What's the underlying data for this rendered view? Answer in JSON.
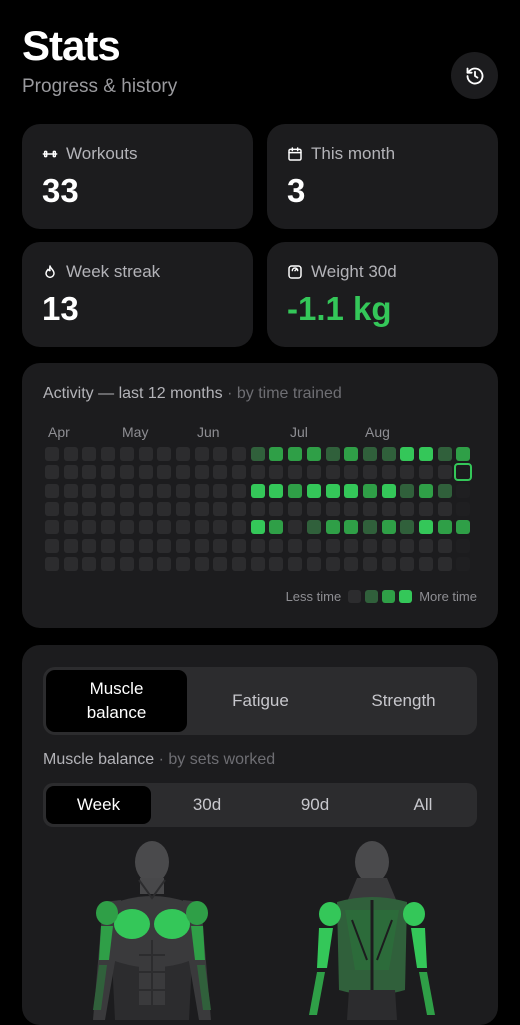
{
  "header": {
    "title": "Stats",
    "subtitle": "Progress & history"
  },
  "stats": [
    {
      "label": "Workouts",
      "value": "33",
      "icon": "dumbbell-icon"
    },
    {
      "label": "This month",
      "value": "3",
      "icon": "calendar-icon"
    },
    {
      "label": "Week streak",
      "value": "13",
      "icon": "flame-icon"
    },
    {
      "label": "Weight 30d",
      "value": "-1.1 kg",
      "icon": "scale-icon",
      "accent": "#34c759"
    }
  ],
  "activity": {
    "title": "Activity — last 12 months",
    "subtitle": "· by time trained",
    "months": [
      "Apr",
      "May",
      "Jun",
      "Jul",
      "Aug"
    ],
    "grid_rows": [
      "00000000000122212113312",
      "0000000000000000000000T",
      "00000000000332333231210",
      "00000000000000000000000",
      "00000000000320122121322",
      "00000000000000000000000",
      "00000000000000000000000"
    ],
    "legend_less": "Less time",
    "legend_more": "More time",
    "level_colors": [
      "#2c2c2e",
      "#30603b",
      "#2f9f47",
      "#34c759"
    ]
  },
  "muscle": {
    "tabs": [
      "Muscle balance",
      "Fatigue",
      "Strength"
    ],
    "active_tab": 0,
    "title": "Muscle balance",
    "subtitle": "· by sets worked",
    "ranges": [
      "Week",
      "30d",
      "90d",
      "All"
    ],
    "active_range": 0
  }
}
